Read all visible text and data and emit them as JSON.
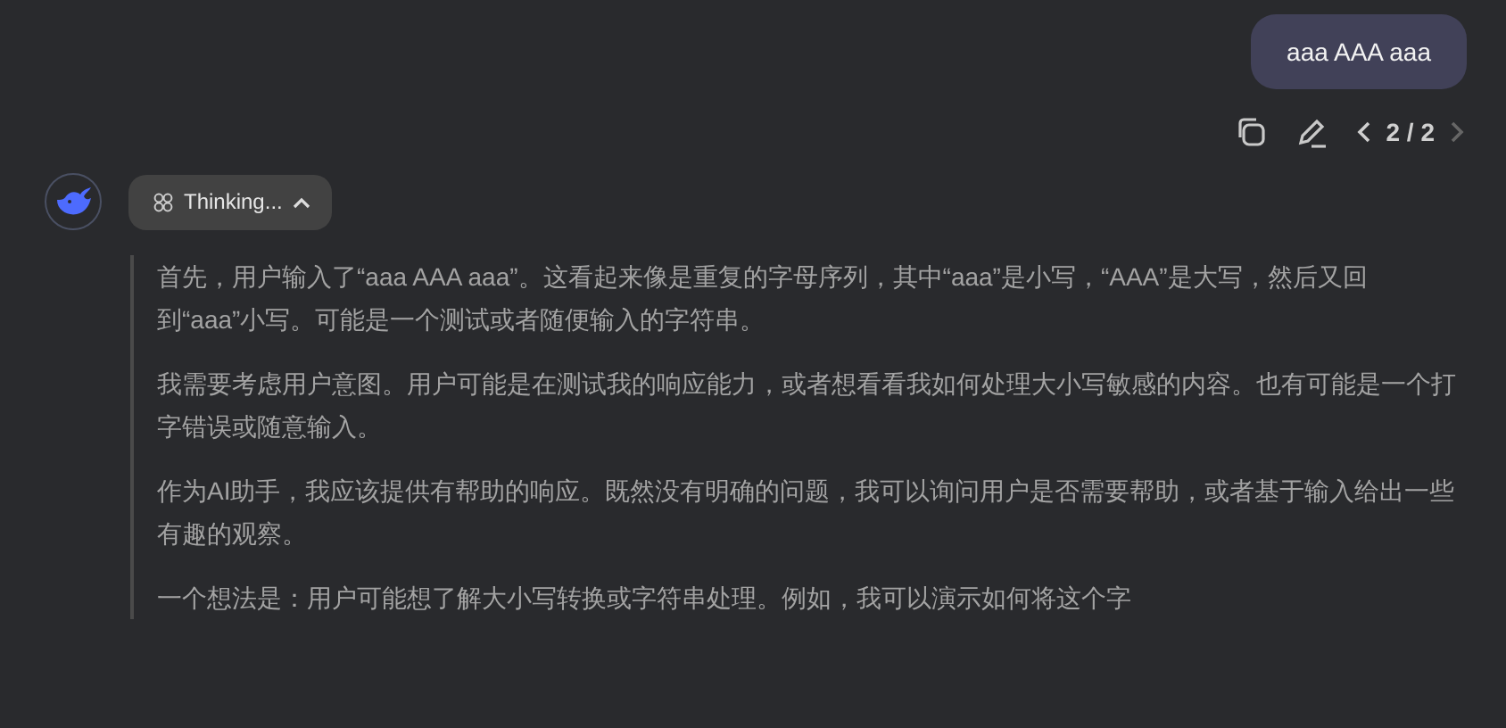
{
  "user_message": {
    "text": "aaa AAA aaa"
  },
  "message_actions": {
    "pager": "2 / 2",
    "prev_disabled": false,
    "next_disabled": true
  },
  "thinking_toggle": {
    "label": "Thinking...",
    "expanded": true
  },
  "thinking_paragraphs": [
    "首先，用户输入了“aaa AAA aaa”。这看起来像是重复的字母序列，其中“aaa”是小写，“AAA”是大写，然后又回到“aaa”小写。可能是一个测试或者随便输入的字符串。",
    "我需要考虑用户意图。用户可能是在测试我的响应能力，或者想看看我如何处理大小写敏感的内容。也有可能是一个打字错误或随意输入。",
    "作为AI助手，我应该提供有帮助的响应。既然没有明确的问题，我可以询问用户是否需要帮助，或者基于输入给出一些有趣的观察。",
    "一个想法是：用户可能想了解大小写转换或字符串处理。例如，我可以演示如何将这个字"
  ]
}
